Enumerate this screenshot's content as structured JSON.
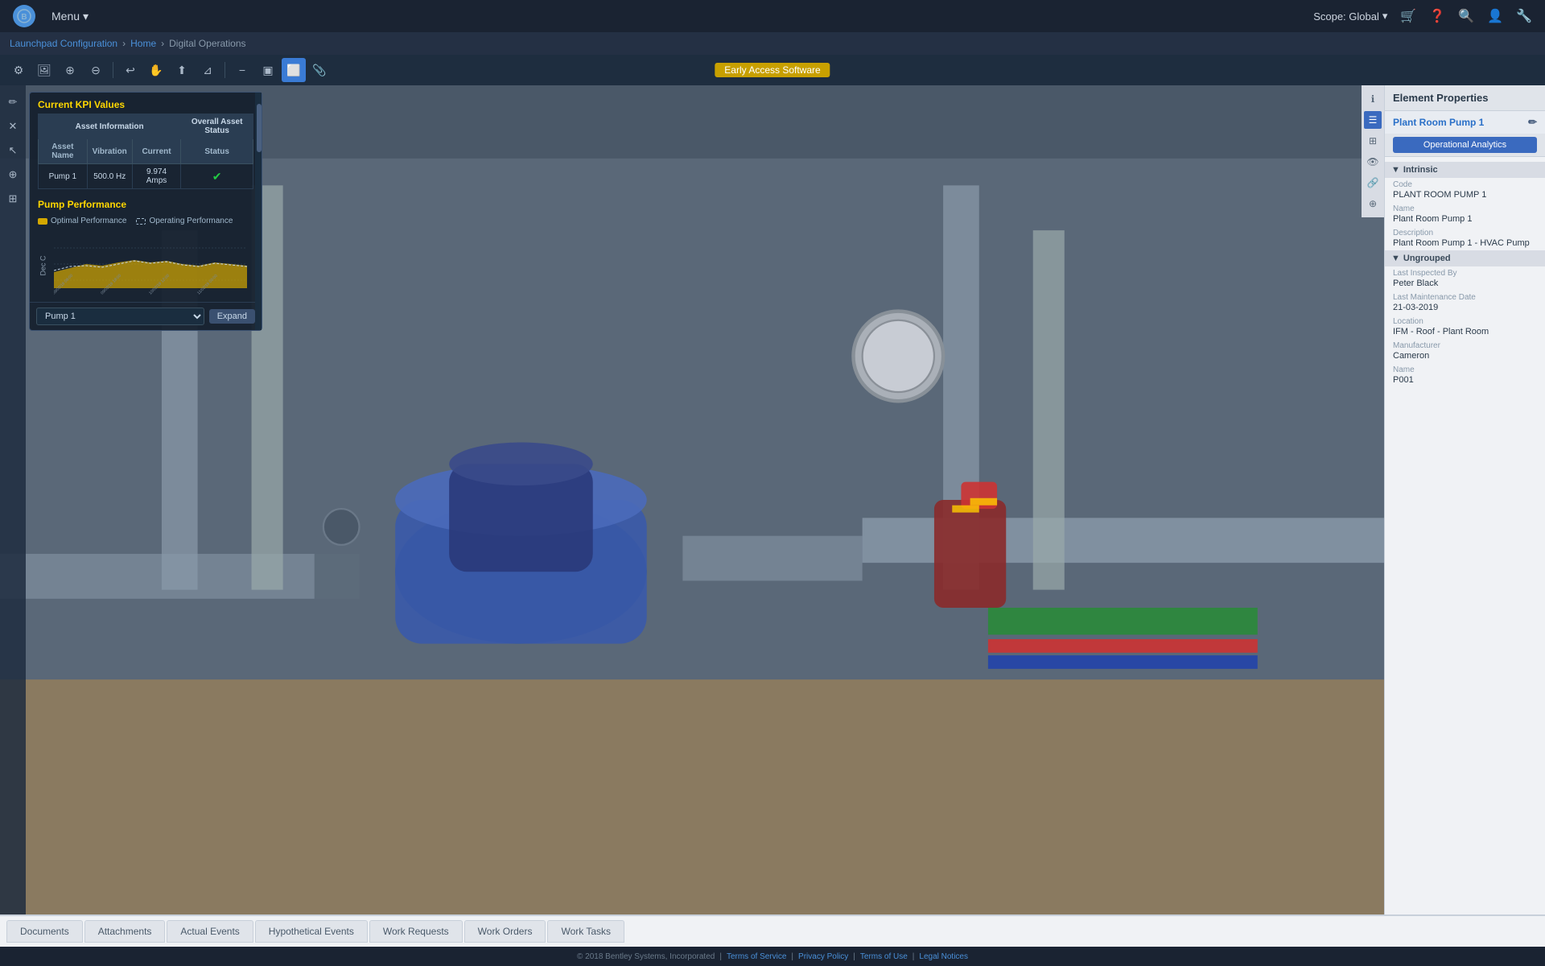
{
  "app": {
    "logo": "B",
    "menu_label": "Menu",
    "early_access": "Early Access Software"
  },
  "nav": {
    "scope_label": "Scope: Global",
    "breadcrumb": [
      {
        "label": "Launchpad Configuration",
        "href": "#"
      },
      {
        "label": "Home",
        "href": "#"
      },
      {
        "label": "Digital Operations",
        "href": null
      }
    ]
  },
  "toolbar": {
    "buttons": [
      {
        "name": "settings-btn",
        "icon": "⚙",
        "tooltip": "Settings"
      },
      {
        "name": "image-btn",
        "icon": "🖼",
        "tooltip": "Image"
      },
      {
        "name": "zoom-in-btn",
        "icon": "🔍",
        "tooltip": "Zoom In"
      },
      {
        "name": "zoom-out-btn",
        "icon": "🔎",
        "tooltip": "Zoom Out"
      },
      {
        "name": "undo-btn",
        "icon": "↩",
        "tooltip": "Undo"
      },
      {
        "name": "pan-btn",
        "icon": "✋",
        "tooltip": "Pan"
      },
      {
        "name": "pointer-btn",
        "icon": "⬆",
        "tooltip": "Pointer"
      },
      {
        "name": "ruler-btn",
        "icon": "📐",
        "tooltip": "Measure"
      },
      {
        "name": "minus-btn",
        "icon": "−",
        "tooltip": "Minus"
      },
      {
        "name": "section-btn",
        "icon": "▣",
        "tooltip": "Section"
      },
      {
        "name": "select-btn",
        "icon": "⬜",
        "tooltip": "Select",
        "active": true
      },
      {
        "name": "attach-btn",
        "icon": "📎",
        "tooltip": "Attach"
      }
    ]
  },
  "kpi_panel": {
    "title": "Current KPI Values",
    "asset_info_header": "Asset Information",
    "overall_status_header": "Overall Asset Status",
    "table_headers": [
      "Asset Name",
      "Vibration",
      "Current",
      "Status"
    ],
    "rows": [
      {
        "name": "Pump 1",
        "vibration": "500.0 Hz",
        "current": "9.974 Amps",
        "status": "ok"
      }
    ],
    "pump_performance_title": "Pump Performance",
    "legend": [
      {
        "label": "Optimal Performance",
        "type": "optimal"
      },
      {
        "label": "Operating Performance",
        "type": "operating"
      }
    ],
    "chart_y_label": "Dec C",
    "chart_dates": [
      "09/02/19 06:00",
      "09/02/19 12:00",
      "09/02/19 18:00",
      "10/02/19 00:00",
      "10/02/19 06:00",
      "10/02/19 12:00",
      "11/02/19 00:00",
      "12/02/19 04:00",
      "28/02/19 06:00"
    ],
    "selector_value": "Pump 1",
    "expand_label": "Expand"
  },
  "viewport": {
    "scene_description": "Industrial plant room with pumps and piping"
  },
  "right_panel": {
    "title": "Element Properties",
    "asset_name": "Plant Room Pump 1",
    "edit_icon": "✏",
    "ops_analytics_label": "Operational Analytics",
    "sections": {
      "intrinsic": {
        "label": "Intrinsic",
        "fields": [
          {
            "label": "Code",
            "value": "PLANT ROOM PUMP 1",
            "highlight": false
          },
          {
            "label": "Name",
            "value": "Plant Room Pump 1",
            "highlight": false
          },
          {
            "label": "Description",
            "value": "Plant Room Pump 1 - HVAC Pump",
            "highlight": false
          }
        ]
      },
      "ungrouped": {
        "label": "Ungrouped",
        "fields": [
          {
            "label": "Last Inspected By",
            "value": "Peter Black",
            "highlight": false
          },
          {
            "label": "Last Maintenance Date",
            "value": "21-03-2019",
            "highlight": false
          },
          {
            "label": "Location",
            "value": "IFM - Roof - Plant Room",
            "highlight": false
          },
          {
            "label": "Manufacturer",
            "value": "Cameron",
            "highlight": false
          },
          {
            "label": "Name",
            "value": "P001",
            "highlight": false
          }
        ]
      }
    },
    "icon_tabs": [
      {
        "name": "info-tab",
        "icon": "ℹ",
        "active": false
      },
      {
        "name": "list-tab",
        "icon": "☰",
        "active": true
      },
      {
        "name": "grid-tab",
        "icon": "⊞",
        "active": false
      },
      {
        "name": "eye-tab",
        "icon": "👁",
        "active": false
      },
      {
        "name": "link-tab",
        "icon": "🔗",
        "active": false
      },
      {
        "name": "layers-tab",
        "icon": "⊕",
        "active": false
      }
    ]
  },
  "bottom_tabs": [
    {
      "label": "Documents",
      "active": false
    },
    {
      "label": "Attachments",
      "active": false
    },
    {
      "label": "Actual Events",
      "active": false
    },
    {
      "label": "Hypothetical Events",
      "active": false
    },
    {
      "label": "Work Requests",
      "active": false
    },
    {
      "label": "Work Orders",
      "active": false
    },
    {
      "label": "Work Tasks",
      "active": false
    }
  ],
  "footer": {
    "copyright": "© 2018 Bentley Systems, Incorporated",
    "links": [
      "Terms of Service",
      "Privacy Policy",
      "Terms of Use",
      "Legal Notices"
    ]
  }
}
